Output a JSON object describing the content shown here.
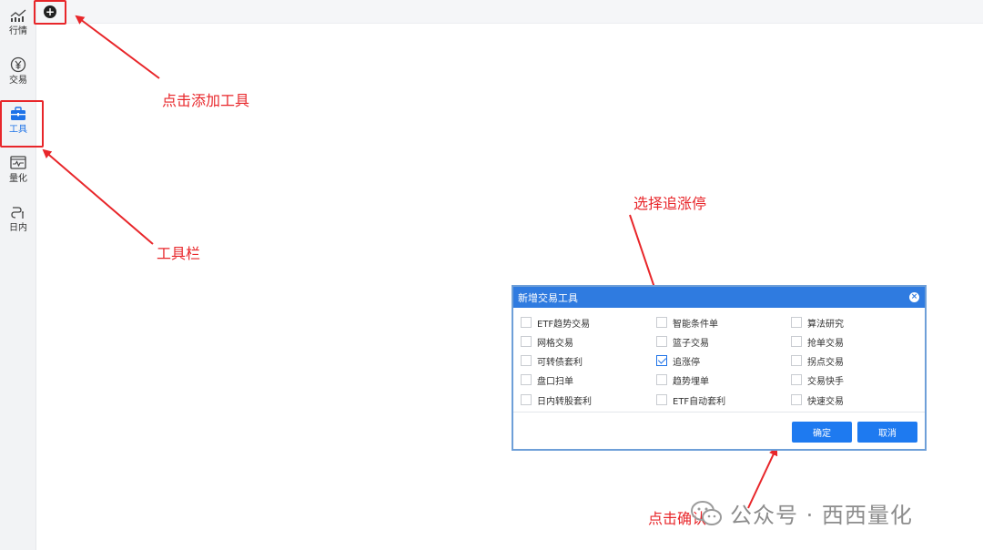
{
  "sidebar": {
    "items": [
      {
        "label": "行情",
        "icon": "market-chart-icon"
      },
      {
        "label": "交易",
        "icon": "yuan-trade-icon"
      },
      {
        "label": "工具",
        "icon": "toolbox-icon"
      },
      {
        "label": "量化",
        "icon": "quant-monitor-icon"
      },
      {
        "label": "日内",
        "icon": "intraday-icon"
      }
    ],
    "active": "工具"
  },
  "topbar": {
    "add_symbol": "+"
  },
  "annotations": {
    "add_tool": "点击添加工具",
    "toolbar": "工具栏",
    "select_chase": "选择追涨停",
    "click_confirm": "点击确认"
  },
  "dialog": {
    "title": "新增交易工具",
    "close_symbol": "×",
    "options": [
      {
        "label": "ETF趋势交易",
        "checked": false
      },
      {
        "label": "智能条件单",
        "checked": false
      },
      {
        "label": "算法研究",
        "checked": false
      },
      {
        "label": "网格交易",
        "checked": false
      },
      {
        "label": "篮子交易",
        "checked": false
      },
      {
        "label": "抢单交易",
        "checked": false
      },
      {
        "label": "可转债套利",
        "checked": false
      },
      {
        "label": "追涨停",
        "checked": true
      },
      {
        "label": "拐点交易",
        "checked": false
      },
      {
        "label": "盘口扫单",
        "checked": false
      },
      {
        "label": "趋势埋单",
        "checked": false
      },
      {
        "label": "交易快手",
        "checked": false
      },
      {
        "label": "日内转股套利",
        "checked": false
      },
      {
        "label": "ETF自动套利",
        "checked": false
      },
      {
        "label": "快速交易",
        "checked": false
      }
    ],
    "confirm_label": "确定",
    "cancel_label": "取消"
  },
  "watermark": {
    "text": "公众号 · 西西量化"
  },
  "colors": {
    "accent": "#1e7af0",
    "annotation": "#e8262a",
    "header": "#2f7be0"
  }
}
